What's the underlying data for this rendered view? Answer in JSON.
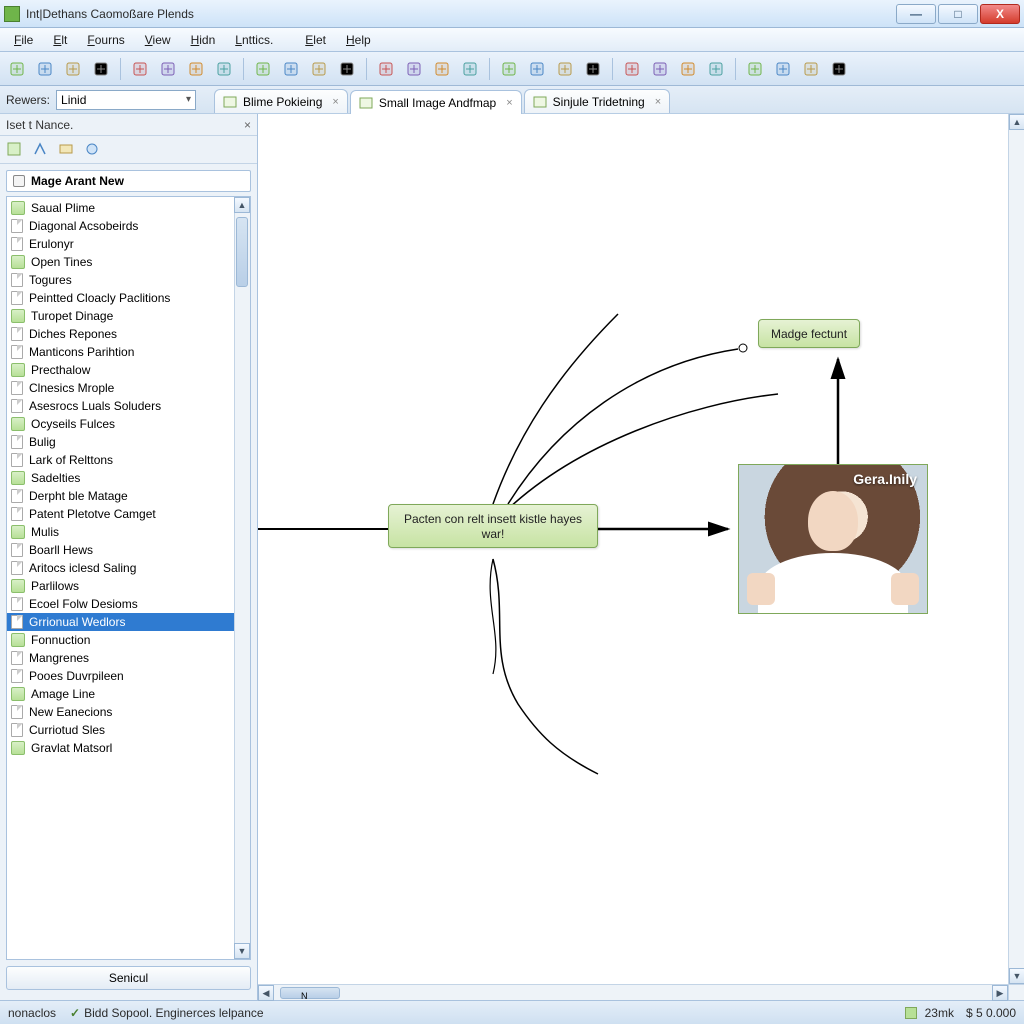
{
  "window": {
    "title": "Int|Dethans Caomoßare Plends",
    "controls": {
      "min": "—",
      "max": "□",
      "close": "X"
    }
  },
  "menu": [
    "File",
    "Elt",
    "Fourns",
    "View",
    "Hidn",
    "Lnttics.",
    "Elet",
    "Help"
  ],
  "rewers": {
    "label": "Rewers:",
    "value": "Linid"
  },
  "tabs": [
    {
      "label": "Blime Pokieing",
      "active": false
    },
    {
      "label": "Small Image Andfmap",
      "active": true
    },
    {
      "label": "Sinjule Tridetning",
      "active": false
    }
  ],
  "sidebar": {
    "panel_title": "Iset t Nance.",
    "section_title": "Mage Arant New",
    "items": [
      "Saual Plime",
      "Diagonal Acsobeirds",
      "Erulonyr",
      "Open Tines",
      "Togures",
      "Peintted Cloacly Paclitions",
      "Turopet Dinage",
      "Diches Repones",
      "Manticons Parihtion",
      "Precthalow",
      "Clnesics Mrople",
      "Asesrocs Luals Soluders",
      "Ocyseils Fulces",
      "Bulig",
      "Lark of Relttons",
      "Sadelties",
      "Derpht ble Matage",
      "Patent Pletotve Camget",
      "Mulis",
      "Boarll Hews",
      "Aritocs iclesd Saling",
      "Parlilows",
      "Ecoel Folw Desioms",
      "Grrionual Wedlors",
      "Fonnuction",
      "Mangrenes",
      "Pooes Duvrpileen",
      "Amage Line",
      "New Eanecions",
      "Curriotud Sles",
      "Gravlat Matsorl"
    ],
    "selected_index": 23,
    "bottom_button": "Senicul"
  },
  "canvas": {
    "center_node": "Pacten con relt insett kistle hayes war!",
    "top_node": "Madge fectunt",
    "image_caption": "Gera.Inily",
    "hscroll_marker": "N"
  },
  "status": {
    "left": "nonaclos",
    "check_text": "Bidd Sopool. Enginerces lelpance",
    "right1": "23mk",
    "right2": "$ 5 0.000"
  },
  "toolbar_count": 28
}
